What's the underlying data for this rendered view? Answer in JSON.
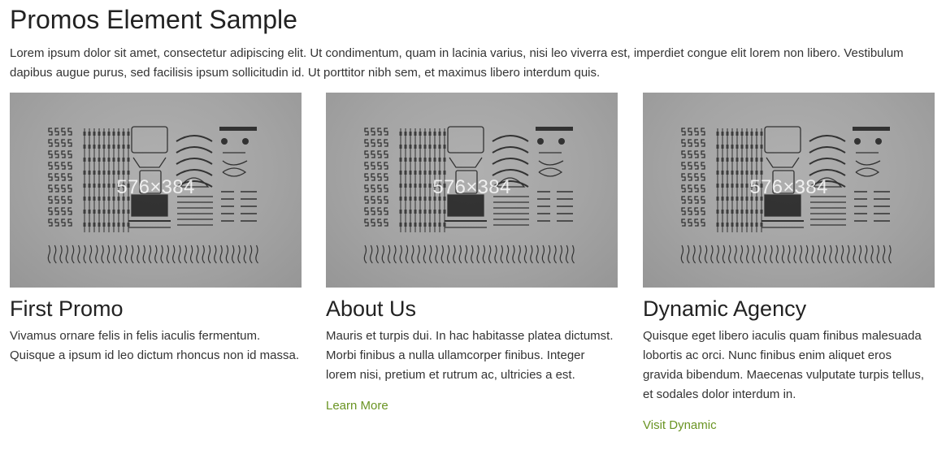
{
  "page": {
    "title": "Promos Element Sample",
    "intro": "Lorem ipsum dolor sit amet, consectetur adipiscing elit. Ut condimentum, quam in lacinia varius, nisi leo viverra est, imperdiet congue elit lorem non libero. Vestibulum dapibus augue purus, sed facilisis ipsum sollicitudin id. Ut porttitor nibh sem, et maximus libero interdum quis."
  },
  "colors": {
    "link": "#6a9423",
    "image_bg": "#a4a4a4",
    "text": "#333333"
  },
  "promos": [
    {
      "image_label": "576×384",
      "title": "First Promo",
      "text": "Vivamus ornare felis in felis iaculis fermentum. Quisque a ipsum id leo dictum rhoncus non id massa.",
      "link": ""
    },
    {
      "image_label": "576×384",
      "title": "About Us",
      "text": "Mauris et turpis dui. In hac habitasse platea dictumst. Morbi finibus a nulla ullamcorper finibus. Integer lorem nisi, pretium et rutrum ac, ultricies a est.",
      "link": "Learn More"
    },
    {
      "image_label": "576×384",
      "title": "Dynamic Agency",
      "text": "Quisque eget libero iaculis quam finibus malesuada lobortis ac orci. Nunc finibus enim aliquet eros gravida bibendum. Maecenas vulputate turpis tellus, et sodales dolor interdum in.",
      "link": "Visit Dynamic"
    }
  ]
}
